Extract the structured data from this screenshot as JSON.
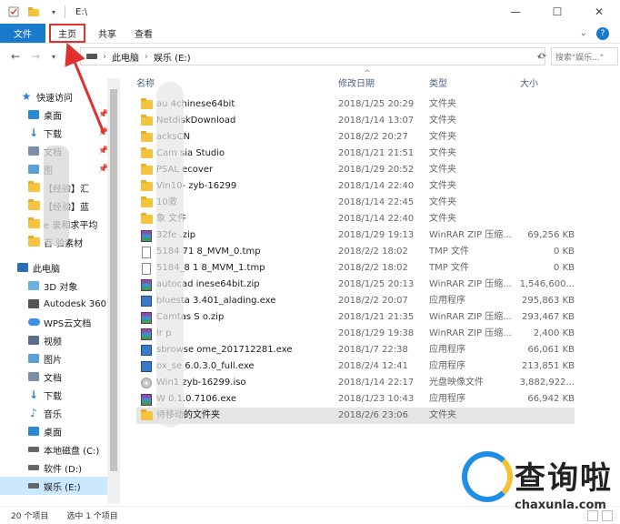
{
  "title_bar": {
    "title": "E:\\"
  },
  "ribbon": {
    "tabs": [
      {
        "label": "文件"
      },
      {
        "label": "主页"
      },
      {
        "label": "共享"
      },
      {
        "label": "查看"
      }
    ]
  },
  "address": {
    "segments": [
      "此电脑",
      "娱乐 (E:)"
    ],
    "search_placeholder": "搜索\"娱乐...\""
  },
  "sidebar": {
    "items": [
      {
        "label": "快速访问",
        "icon": "star-icon"
      },
      {
        "label": "桌面",
        "icon": "desktop-icon"
      },
      {
        "label": "下载",
        "icon": "download-icon"
      },
      {
        "label": "文档",
        "icon": "document-icon"
      },
      {
        "label": "图",
        "icon": "picture-icon"
      },
      {
        "label": "【经验】汇",
        "icon": "folder-icon"
      },
      {
        "label": "【经验】蓝",
        "icon": "folder-icon"
      },
      {
        "label": "e 录和求平均",
        "icon": "folder-icon"
      },
      {
        "label": "百 验素材",
        "icon": "folder-icon"
      },
      {
        "label": "此电脑",
        "icon": "computer-icon"
      },
      {
        "label": "3D 对象",
        "icon": "cube-icon"
      },
      {
        "label": "Autodesk 360",
        "icon": "autodesk-icon"
      },
      {
        "label": "WPS云文档",
        "icon": "cloud-icon"
      },
      {
        "label": "视频",
        "icon": "video-icon"
      },
      {
        "label": "图片",
        "icon": "picture-icon"
      },
      {
        "label": "文档",
        "icon": "document-icon"
      },
      {
        "label": "下载",
        "icon": "download-icon"
      },
      {
        "label": "音乐",
        "icon": "music-icon"
      },
      {
        "label": "桌面",
        "icon": "desktop-icon"
      },
      {
        "label": "本地磁盘 (C:)",
        "icon": "drive-icon"
      },
      {
        "label": "软件 (D:)",
        "icon": "drive-icon"
      },
      {
        "label": "娱乐 (E:)",
        "icon": "drive-icon"
      }
    ]
  },
  "columns": {
    "name": "名称",
    "date": "修改日期",
    "type": "类型",
    "size": "大小"
  },
  "files": [
    {
      "name": "au 4chinese64bit",
      "date": "2018/1/25 20:29",
      "type": "文件夹",
      "size": "",
      "icon": "folder"
    },
    {
      "name": "NetdiskDownload",
      "date": "2018/1/14 13:07",
      "type": "文件夹",
      "size": "",
      "icon": "folder"
    },
    {
      "name": "acksCN",
      "date": "2018/2/2 20:27",
      "type": "文件夹",
      "size": "",
      "icon": "folder"
    },
    {
      "name": "Cam sia Studio",
      "date": "2018/1/21 21:51",
      "type": "文件夹",
      "size": "",
      "icon": "folder"
    },
    {
      "name": "PSAL ecover",
      "date": "2018/1/29 20:52",
      "type": "文件夹",
      "size": "",
      "icon": "folder"
    },
    {
      "name": "Vin10- zyb-16299",
      "date": "2018/1/14 22:40",
      "type": "文件夹",
      "size": "",
      "icon": "folder"
    },
    {
      "name": "10激",
      "date": "2018/1/14 22:45",
      "type": "文件夹",
      "size": "",
      "icon": "folder"
    },
    {
      "name": "象 文件",
      "date": "2018/1/14 22:40",
      "type": "文件夹",
      "size": "",
      "icon": "folder"
    },
    {
      "name": "32fe .zip",
      "date": "2018/1/29 19:13",
      "type": "WinRAR ZIP 压缩...",
      "size": "69,256 KB",
      "icon": "zip"
    },
    {
      "name": "5184 71 8_MVM_0.tmp",
      "date": "2018/2/2 18:02",
      "type": "TMP 文件",
      "size": "0 KB",
      "icon": "doc"
    },
    {
      "name": "5184_8 1 8_MVM_1.tmp",
      "date": "2018/2/2 18:02",
      "type": "TMP 文件",
      "size": "0 KB",
      "icon": "doc"
    },
    {
      "name": "autocad inese64bit.zip",
      "date": "2018/1/25 20:13",
      "type": "WinRAR ZIP 压缩...",
      "size": "1,546,600...",
      "icon": "zip"
    },
    {
      "name": "bluesta 3.401_alading.exe",
      "date": "2018/2/2 20:07",
      "type": "应用程序",
      "size": "295,863 KB",
      "icon": "exe"
    },
    {
      "name": "Camtas S o.zip",
      "date": "2018/1/21 21:35",
      "type": "WinRAR ZIP 压缩...",
      "size": "293,467 KB",
      "icon": "zip"
    },
    {
      "name": "lr p",
      "date": "2018/1/29 19:38",
      "type": "WinRAR ZIP 压缩...",
      "size": "2,400 KB",
      "icon": "zip"
    },
    {
      "name": "sbrowse ome_201712281.exe",
      "date": "2018/1/7 22:38",
      "type": "应用程序",
      "size": "66,061 KB",
      "icon": "exe"
    },
    {
      "name": "ox_se 6.0.3.0_full.exe",
      "date": "2018/2/4 12:41",
      "type": "应用程序",
      "size": "213,851 KB",
      "icon": "exe"
    },
    {
      "name": "Win1 zyb-16299.iso",
      "date": "2018/1/14 22:17",
      "type": "光盘映像文件",
      "size": "3,882,922...",
      "icon": "iso"
    },
    {
      "name": "W 0.1.0.7106.exe",
      "date": "2018/1/23 10:43",
      "type": "应用程序",
      "size": "66,942 KB",
      "icon": "zip"
    },
    {
      "name": "待移动的文件夹",
      "date": "2018/2/6 23:06",
      "type": "文件夹",
      "size": "",
      "icon": "folder"
    }
  ],
  "status": {
    "count": "20 个项目",
    "selected": "选中 1 个项目"
  },
  "watermark": {
    "title": "查询啦",
    "url": "chaxunla.com"
  },
  "colors": {
    "accent": "#1979ca",
    "highlight_box": "#e03030",
    "selection": "#cce8ff"
  }
}
